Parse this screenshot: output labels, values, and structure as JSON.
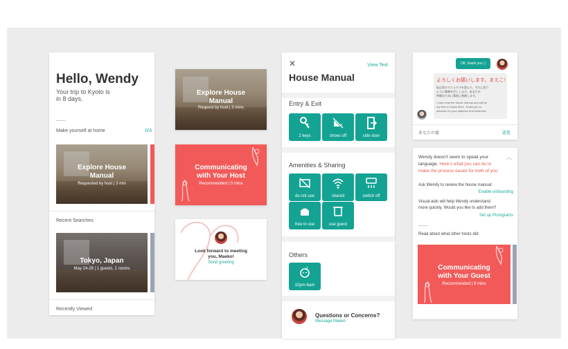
{
  "screen1": {
    "greeting": "Hello, Wendy",
    "trip_line1": "Your trip to Kyoto is",
    "trip_line2": "in 8 days.",
    "section_label": "Make yourself at home",
    "section_count": "0/3",
    "card_title_1": "Explore House",
    "card_title_2": "Manual",
    "card_sub": "Requested by host | 3 min",
    "recent_searches_label": "Recent Searches",
    "search_title": "Tokyo, Japan",
    "search_sub": "May 24-29 | 1 guests, 1 rooms",
    "recently_viewed_label": "Recently Viewed"
  },
  "screen2": {
    "explore_title_1": "Explore House",
    "explore_title_2": "Manual",
    "explore_sub": "Request by host | 3 mins",
    "comm_title_1": "Communicating",
    "comm_title_2": "with Your Host",
    "comm_sub": "Recommended | 5 mins",
    "greeting_line1": "Look forward to meeting",
    "greeting_line2": "you, Maeko!",
    "greeting_link": "Send greeting"
  },
  "screen3": {
    "title": "House Manual",
    "view_text": "View Text",
    "entry_label": "Entry & Exit",
    "entry_tiles": [
      {
        "label": "2 keys",
        "icon": "key-icon"
      },
      {
        "label": "shoes off",
        "icon": "shoes-off-icon"
      },
      {
        "label": "side door",
        "icon": "door-icon"
      }
    ],
    "amenities_label": "Amenities & Sharing",
    "amenity_tiles": [
      {
        "label": "do not use",
        "icon": "tv-crossed-icon"
      },
      {
        "label": "shared",
        "icon": "wifi-icon"
      },
      {
        "label": "switch off",
        "icon": "ac-icon"
      },
      {
        "label": "free to use",
        "icon": "cooker-icon"
      },
      {
        "label": "use guest",
        "icon": "towel-icon"
      }
    ],
    "others_label": "Others",
    "others_tile": {
      "label": "10pm-6am",
      "icon": "quiet-hours-icon"
    },
    "questions": "Questions or Concerns?",
    "message_link": "Message Maeko"
  },
  "screen4": {
    "bubble_out": "OK, thank you :)",
    "bubble_in_head": "よろしくお願いします。まえこ!",
    "bubble_in_jp1": "私は家のマニュアルを読んで、それに従う",
    "bubble_in_jp2": "ように最善を尽くします。あなたの",
    "bubble_in_jp3": "時間のために事前に感謝します。",
    "bubble_in_en1": "I have read the house manual and will try",
    "bubble_in_en2": "my best to follow them. Thank you in",
    "bubble_in_en3": "advance for your patience and kindness!",
    "input_placeholder": "あなたの番",
    "send_label": "送信"
  },
  "screen5": {
    "intro_1": "Wendy doesn't seem to speak your",
    "intro_2a": "language. ",
    "intro_2b": "Here's what you can do to",
    "intro_3": "make the process easier for both of you:",
    "ask_line": "Ask Wendy to review the house manual:",
    "enable_link": "Enable onboarding",
    "visual_1": "Visual aids will help Wendy understand",
    "visual_2": "more quickly. Would you like to add them?",
    "pictograms_link": "Set up Pictograms",
    "read_line": "Read about what other hosts did:",
    "card_title_1": "Communicating",
    "card_title_2": "with Your Guest",
    "card_sub": "Recommended | 8 mins"
  },
  "colors": {
    "accent": "#1aa89a",
    "coral": "#f25a5a",
    "tile": "#14a393",
    "background": "#ececec"
  }
}
